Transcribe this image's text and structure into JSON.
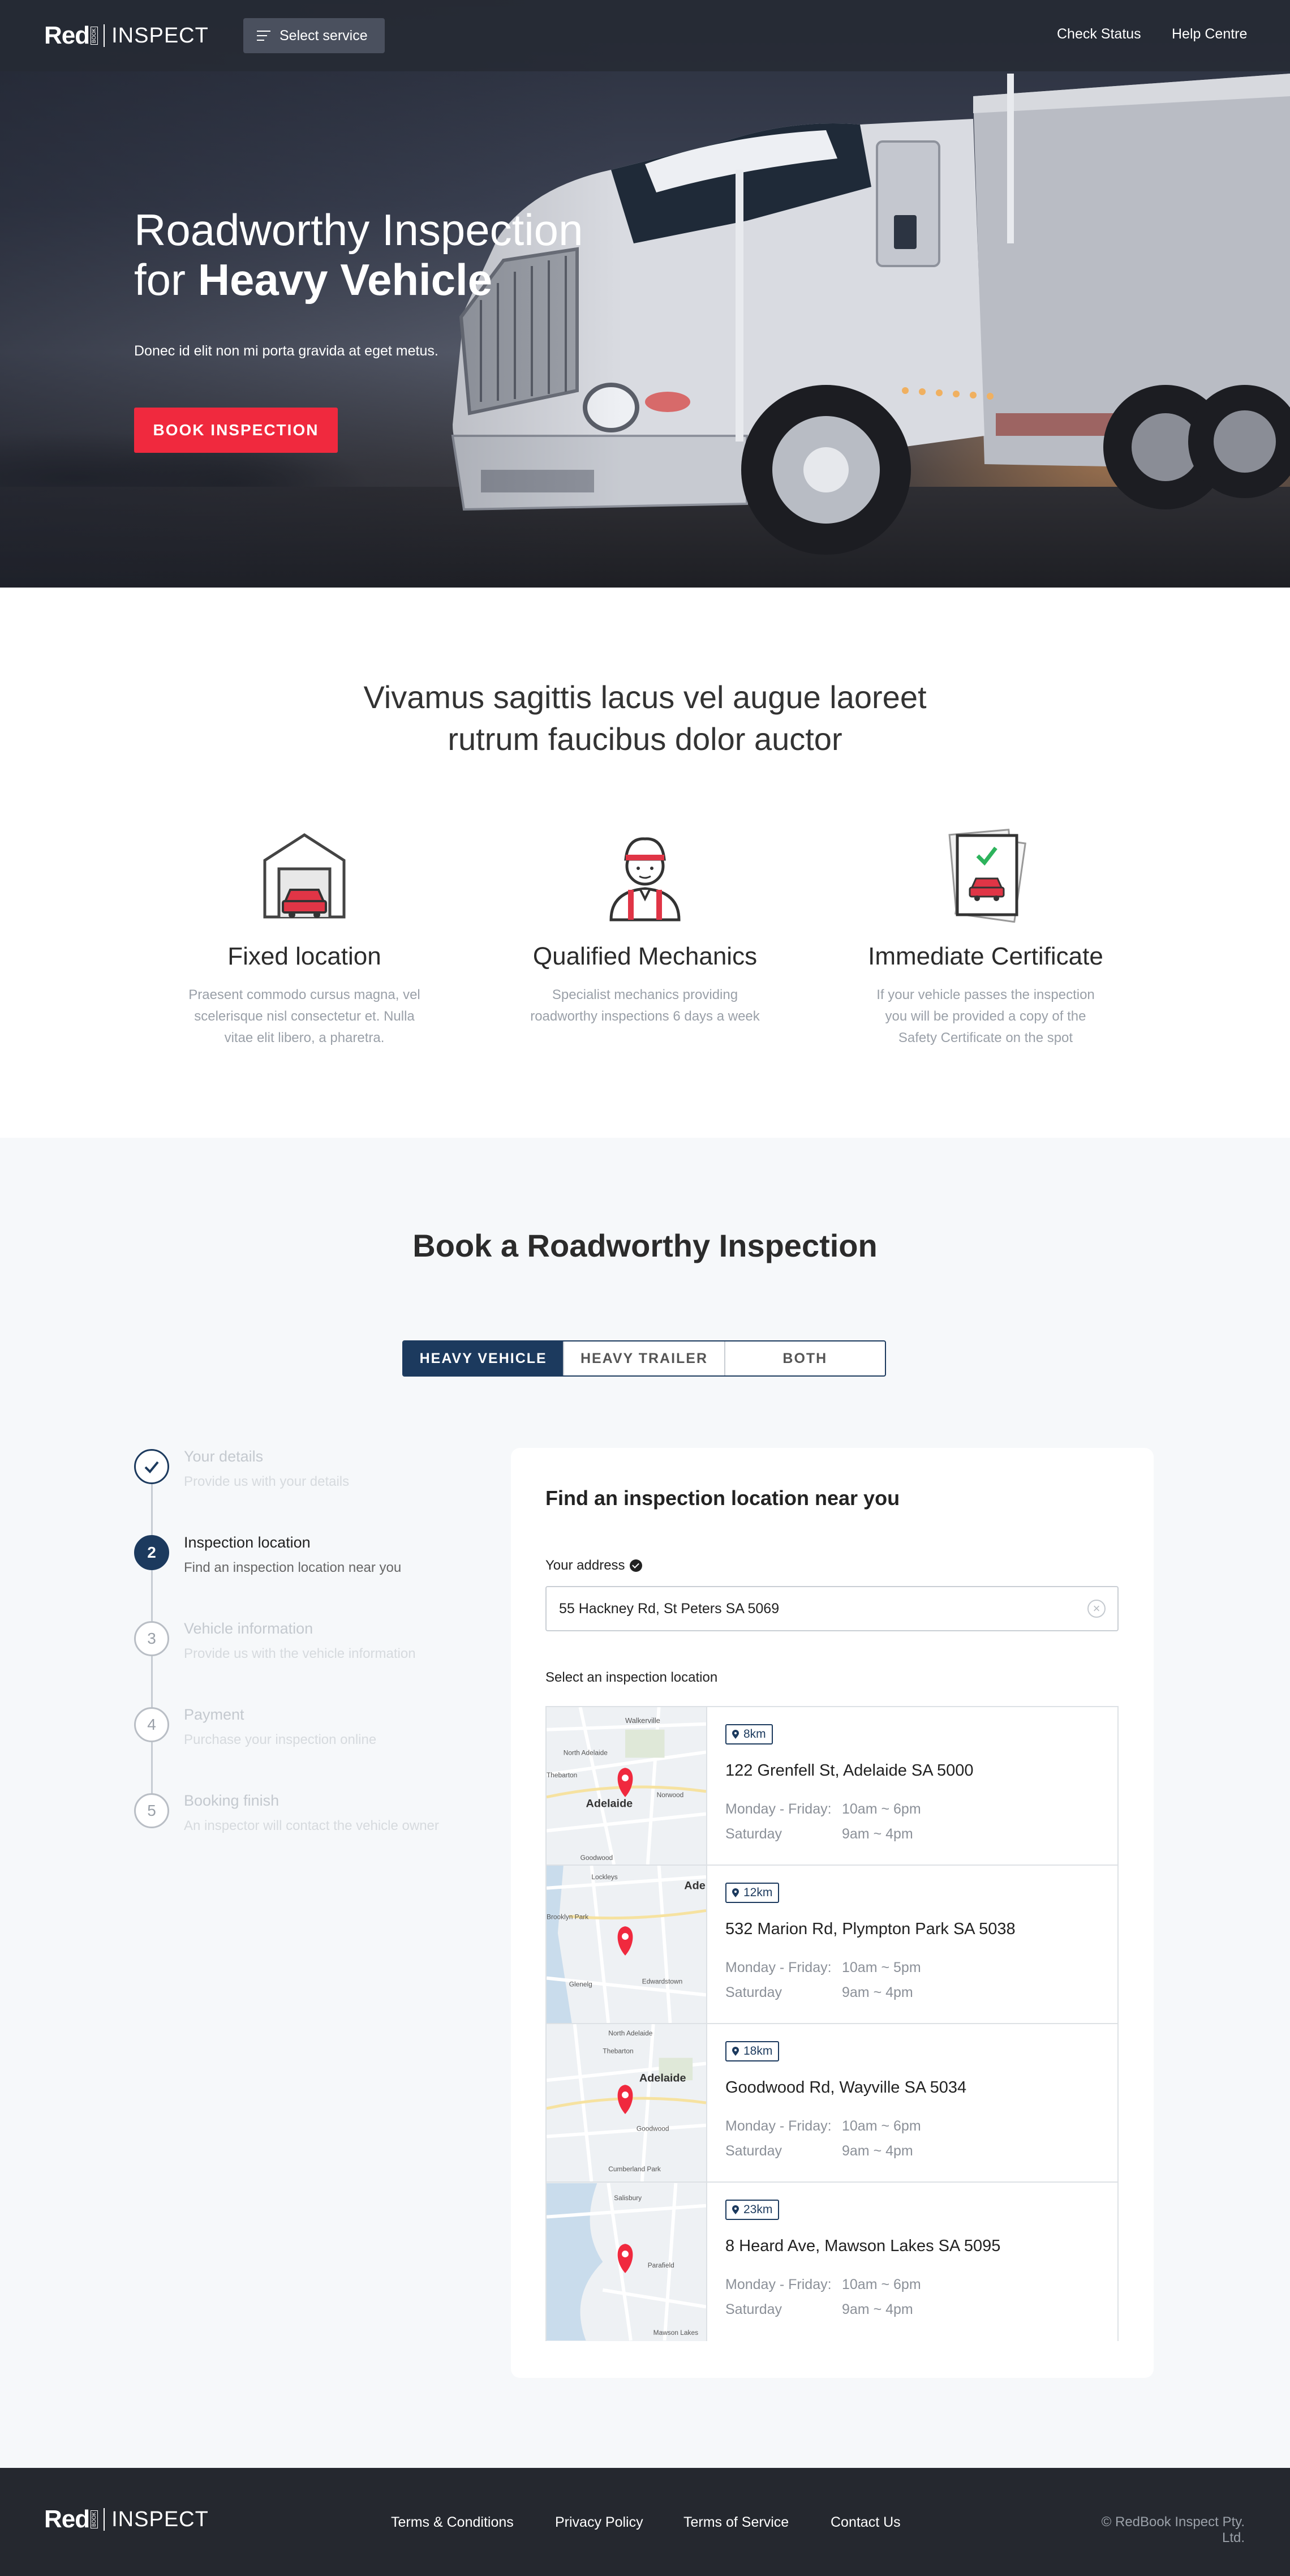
{
  "header": {
    "logo_red": "Red",
    "logo_book": "BOOK",
    "logo_inspect": "INSPECT",
    "select_service": "Select service",
    "nav": [
      "Check Status",
      "Help Centre"
    ]
  },
  "hero": {
    "title_line1": "Roadworthy Inspection",
    "title_prefix": "for ",
    "title_bold": "Heavy Vehicle",
    "subtitle": "Donec id elit non mi porta gravida at eget metus.",
    "cta": "BOOK INSPECTION"
  },
  "features": {
    "title_line1": "Vivamus sagittis lacus vel augue laoreet",
    "title_line2": "rutrum faucibus dolor auctor",
    "items": [
      {
        "icon": "garage-icon",
        "title": "Fixed location",
        "text": "Praesent commodo cursus magna, vel scelerisque nisl consectetur et. Nulla vitae elit libero, a pharetra."
      },
      {
        "icon": "mechanic-icon",
        "title": "Qualified Mechanics",
        "text": "Specialist mechanics providing roadworthy inspections 6 days a week"
      },
      {
        "icon": "certificate-icon",
        "title": "Immediate Certificate",
        "text": "If your vehicle passes the inspection you will be provided a copy of the Safety Certificate on the spot"
      }
    ]
  },
  "booking": {
    "title": "Book a Roadworthy Inspection",
    "tabs": [
      "HEAVY VEHICLE",
      "HEAVY TRAILER",
      "BOTH"
    ],
    "active_tab": 0,
    "steps": [
      {
        "num": "",
        "title": "Your details",
        "desc": "Provide us with your details",
        "state": "done"
      },
      {
        "num": "2",
        "title": "Inspection location",
        "desc": "Find an inspection location near you",
        "state": "current"
      },
      {
        "num": "3",
        "title": "Vehicle information",
        "desc": "Provide us with the vehicle information",
        "state": "pending"
      },
      {
        "num": "4",
        "title": "Payment",
        "desc": "Purchase your inspection online",
        "state": "pending"
      },
      {
        "num": "5",
        "title": "Booking finish",
        "desc": "An inspector will contact the vehicle owner",
        "state": "pending"
      }
    ],
    "panel": {
      "title": "Find an inspection location near you",
      "address_label": "Your address",
      "address_value": "55 Hackney Rd, St Peters SA 5069",
      "select_label": "Select an inspection location",
      "locations": [
        {
          "distance": "8km",
          "address": "122 Grenfell St, Adelaide SA 5000",
          "weekday_label": "Monday - Friday:",
          "weekday_hours": "10am ~ 6pm",
          "sat_label": "Saturday",
          "sat_hours": "9am ~ 4pm",
          "map_labels": [
            "Walkerville",
            "North Adelaide",
            "Thebarton",
            "Adelaide",
            "Norwood",
            "Goodwood"
          ]
        },
        {
          "distance": "12km",
          "address": "532 Marion Rd, Plympton Park SA 5038",
          "weekday_label": "Monday - Friday:",
          "weekday_hours": "10am ~ 5pm",
          "sat_label": "Saturday",
          "sat_hours": "9am ~ 4pm",
          "map_labels": [
            "Ade",
            "Lockleys",
            "Brooklyn Park",
            "Glenelg",
            "Edwardstown"
          ]
        },
        {
          "distance": "18km",
          "address": "Goodwood Rd, Wayville SA 5034",
          "weekday_label": "Monday - Friday:",
          "weekday_hours": "10am ~ 6pm",
          "sat_label": "Saturday",
          "sat_hours": "9am ~ 4pm",
          "map_labels": [
            "North Adelaide",
            "Thebarton",
            "Adelaide",
            "Goodwood",
            "Cumberland Park"
          ]
        },
        {
          "distance": "23km",
          "address": "8 Heard Ave, Mawson Lakes SA 5095",
          "weekday_label": "Monday - Friday:",
          "weekday_hours": "10am ~ 6pm",
          "sat_label": "Saturday",
          "sat_hours": "9am ~ 4pm",
          "map_labels": [
            "Salisbury",
            "Parafield",
            "Mawson Lakes"
          ]
        }
      ]
    }
  },
  "footer": {
    "links": [
      "Terms & Conditions",
      "Privacy Policy",
      "Terms of Service",
      "Contact Us"
    ],
    "copyright": "© RedBook Inspect Pty. Ltd."
  },
  "colors": {
    "accent": "#f0293e",
    "navy": "#1c3a5e",
    "footer_bg": "#25282f"
  }
}
